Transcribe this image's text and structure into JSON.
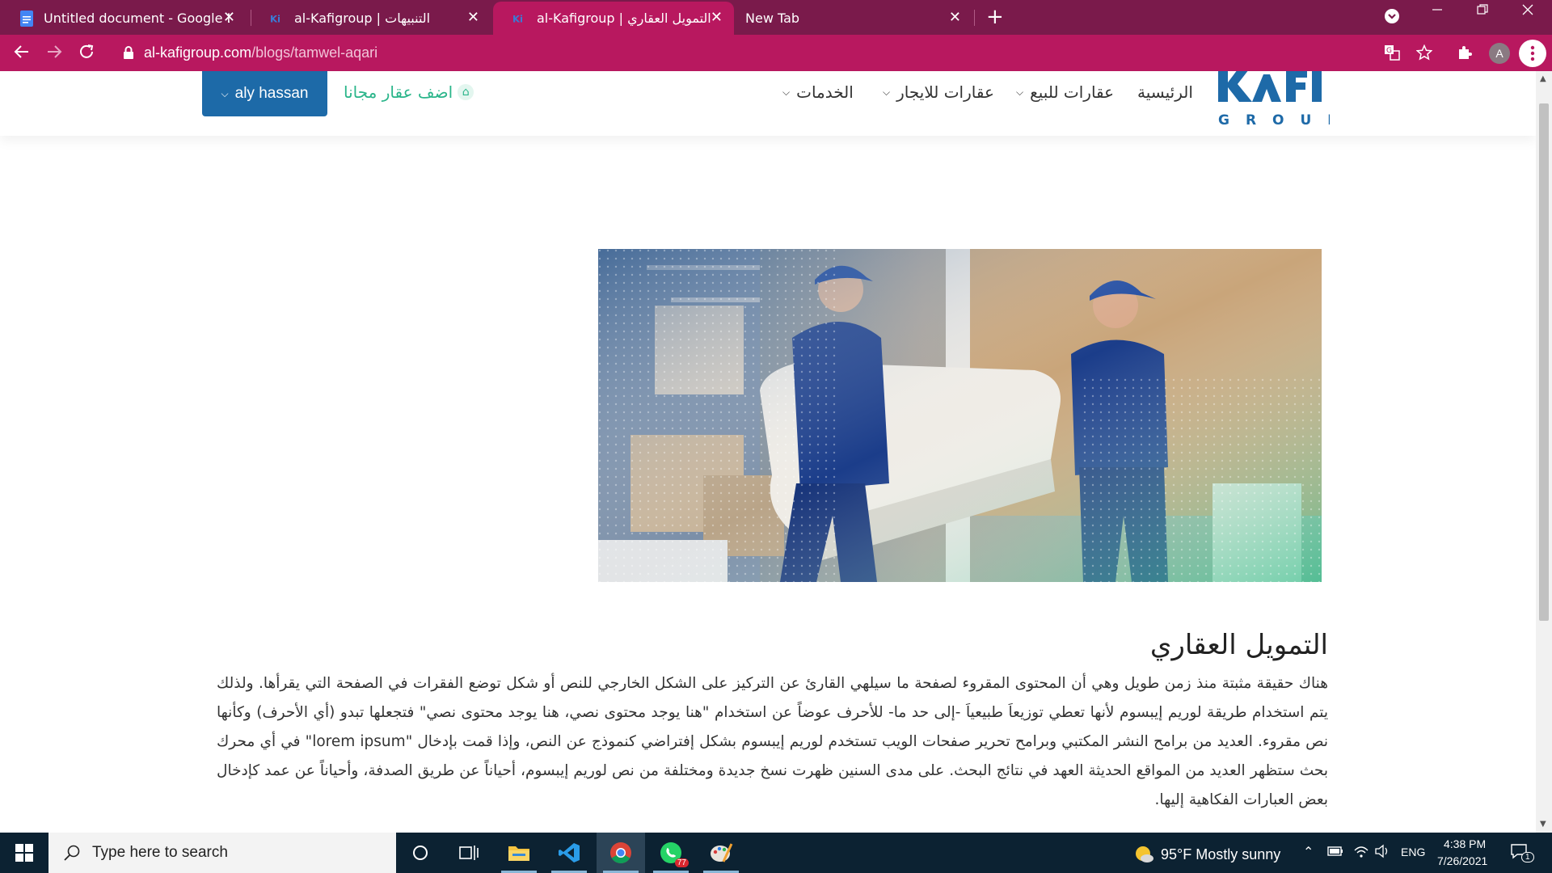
{
  "browser": {
    "tabs": [
      {
        "title": "Untitled document - Google Doc",
        "close": "✕",
        "active": false
      },
      {
        "title": "al-Kafigroup | التنبيهات",
        "close": "✕",
        "active": false
      },
      {
        "title": "al-Kafigroup | التمويل العقاري",
        "close": "✕",
        "active": true
      },
      {
        "title": "New Tab",
        "close": "✕",
        "active": false
      }
    ],
    "new_tab": "+",
    "url_host": "al-kafigroup.com",
    "url_path": "/blogs/tamwel-aqari",
    "profile_initial": "A",
    "colors": {
      "tabstrip": "#7a1a4b",
      "active": "#b8185f"
    }
  },
  "site": {
    "logo_text": "GROUP",
    "nav": {
      "home": "الرئيسية",
      "for_sale": "عقارات للبيع",
      "for_rent": "عقارات للايجار",
      "services": "الخدمات"
    },
    "add_property": "اضف عقار مجانا",
    "user_name": "aly hassan",
    "accent": "#2ab58a",
    "user_button_color": "#1d6aa8"
  },
  "article": {
    "title": "التمويل العقاري",
    "body": "هناك حقيقة مثبتة منذ زمن طويل وهي أن المحتوى المقروء لصفحة ما سيلهي القارئ عن التركيز على الشكل الخارجي للنص أو شكل توضع الفقرات في الصفحة التي يقرأها. ولذلك يتم استخدام طريقة لوريم إيبسوم لأنها تعطي توزيعاَ طبيعياَ -إلى حد ما- للأحرف عوضاً عن استخدام \"هنا يوجد محتوى نصي، هنا يوجد محتوى نصي\" فتجعلها تبدو (أي الأحرف) وكأنها نص مقروء. العديد من برامح النشر المكتبي وبرامح تحرير صفحات الويب تستخدم لوريم إيبسوم بشكل إفتراضي كنموذج عن النص، وإذا قمت بإدخال \"lorem ipsum\" في أي محرك بحث ستظهر العديد من المواقع الحديثة العهد في نتائج البحث. على مدى السنين ظهرت نسخ جديدة ومختلفة من نص لوريم إيبسوم، أحياناً عن طريق الصدفة، وأحياناً عن عمد كإدخال بعض العبارات الفكاهية إليها."
  },
  "taskbar": {
    "search_placeholder": "Type here to search",
    "whatsapp_badge": "77",
    "weather": "95°F  Mostly sunny",
    "language": "ENG",
    "time": "4:38 PM",
    "date": "7/26/2021",
    "notification_count": "1"
  }
}
